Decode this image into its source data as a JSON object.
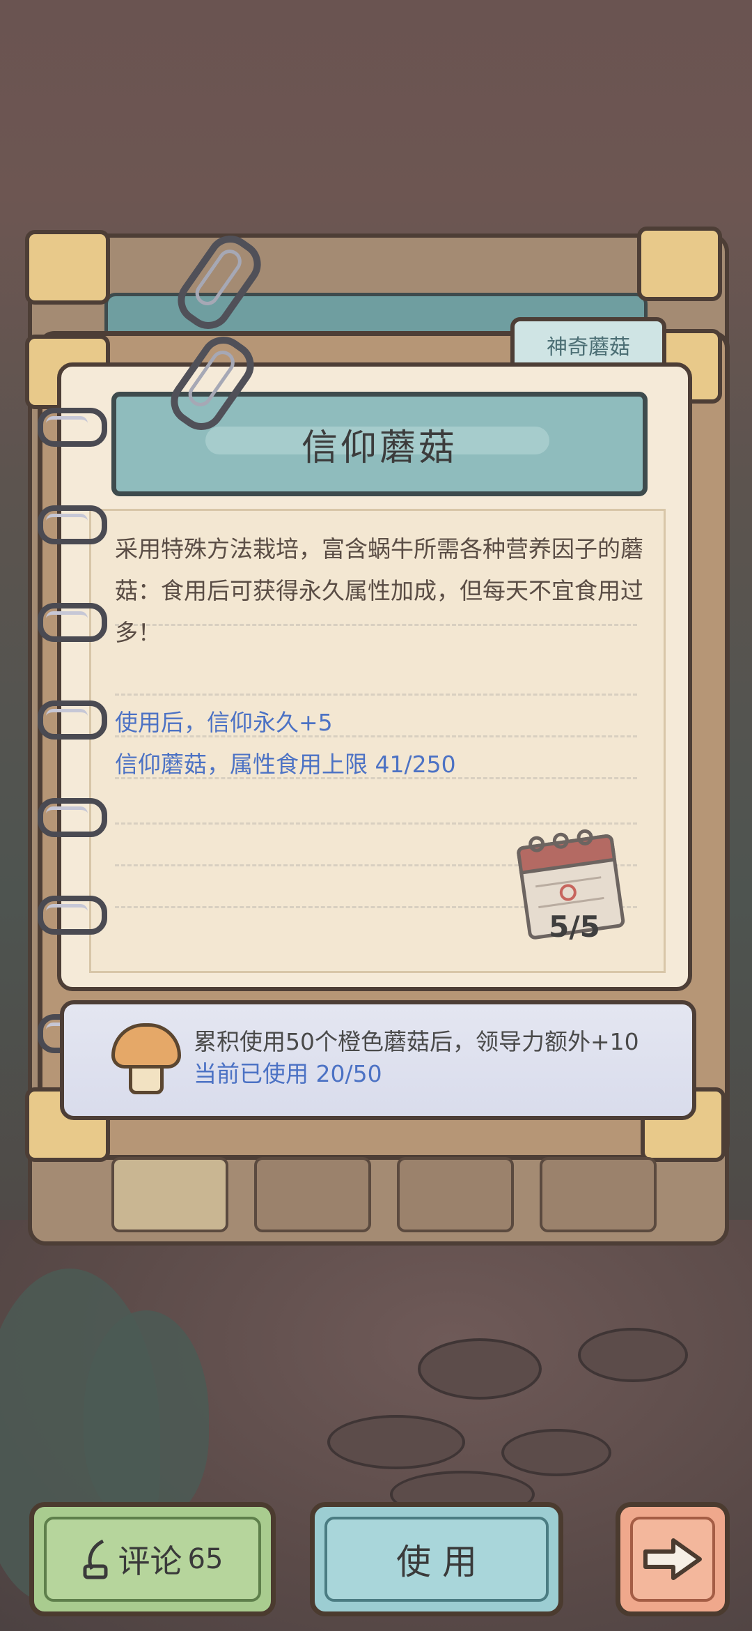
{
  "tab": {
    "label": "神奇蘑菇"
  },
  "item": {
    "title": "信仰蘑菇",
    "description": "采用特殊方法栽培，富含蜗牛所需各种营养因子的蘑菇：食用后可获得永久属性加成，但每天不宜食用过多！",
    "effect": "使用后，信仰永久+5",
    "limit": "信仰蘑菇，属性食用上限 41/250",
    "page": "5/5"
  },
  "bonus": {
    "line1": "累积使用50个橙色蘑菇后，领导力额外+10",
    "line2": "当前已使用 20/50"
  },
  "buttons": {
    "comment_label": "评论",
    "comment_count": "65",
    "use_label": "使 用"
  },
  "colors": {
    "effect_text": "#4c72c4",
    "title_banner": "#8fbcbd",
    "comment_button": "#a9cc8f",
    "use_button": "#9ccdd2",
    "next_button": "#efa88c"
  },
  "icons": [
    "paper-clip-icon",
    "calendar-icon",
    "mushroom-icon",
    "quill-icon",
    "arrow-right-icon"
  ]
}
